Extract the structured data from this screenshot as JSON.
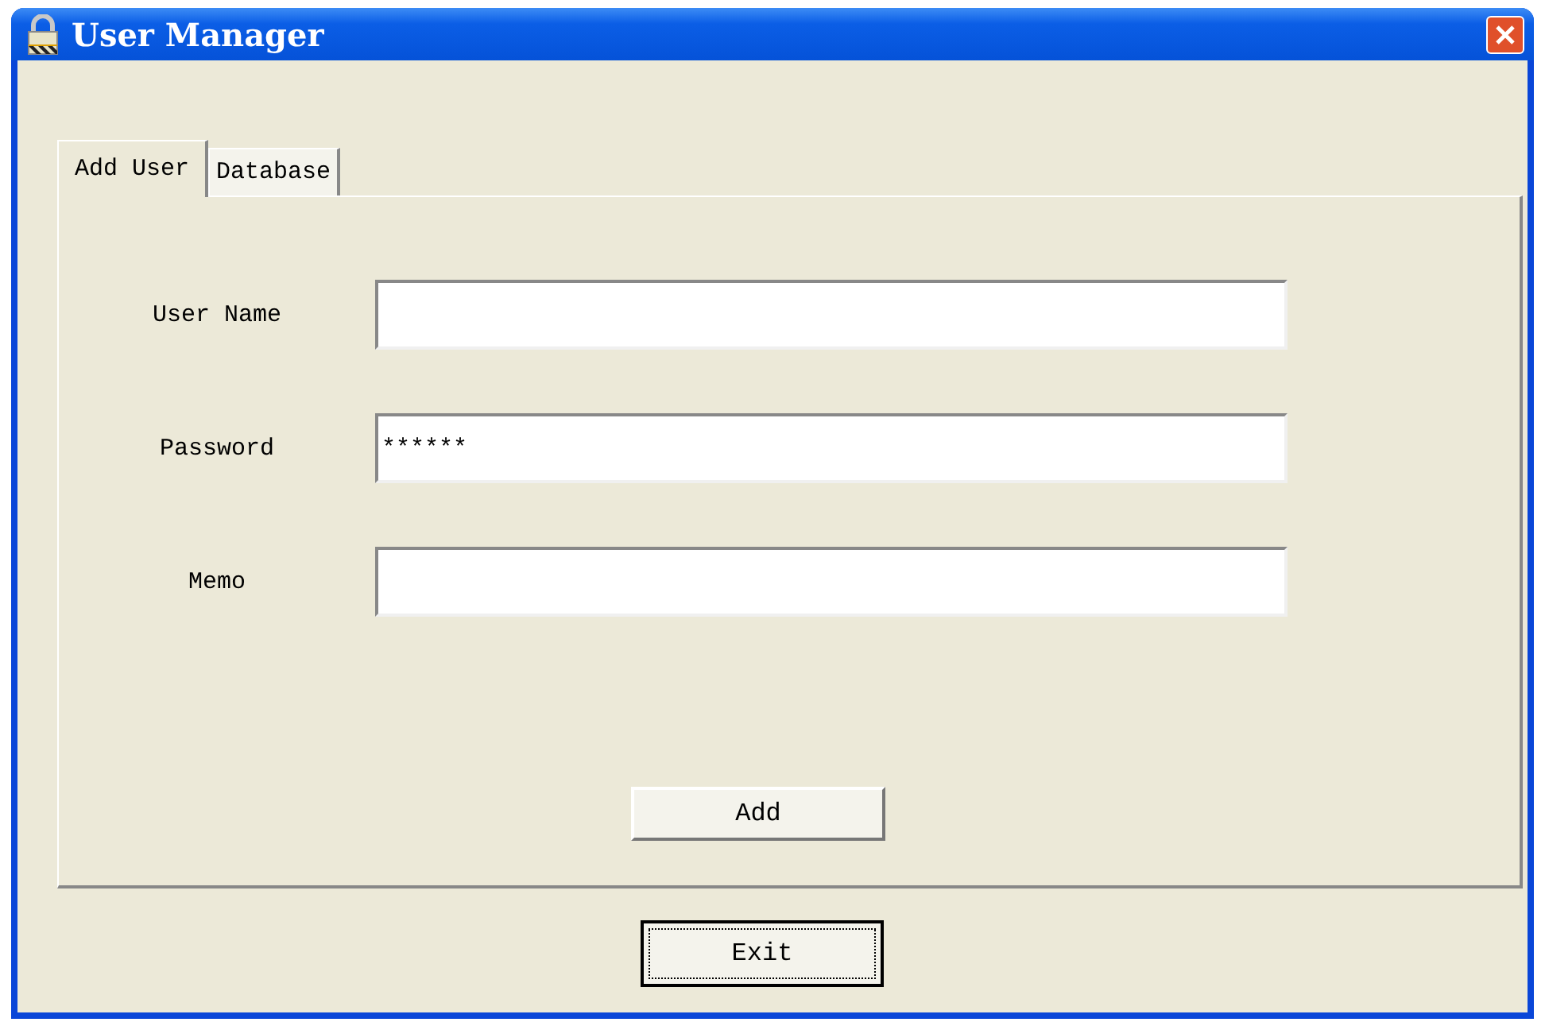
{
  "window": {
    "title": "User Manager"
  },
  "tabs": [
    {
      "label": "Add User",
      "selected": true
    },
    {
      "label": "Database",
      "selected": false
    }
  ],
  "form": {
    "fields": [
      {
        "label": "User Name"
      },
      {
        "label": "Password",
        "value": "******"
      },
      {
        "label": "Memo"
      }
    ],
    "add_button": "Add"
  },
  "exit_button": "Exit"
}
